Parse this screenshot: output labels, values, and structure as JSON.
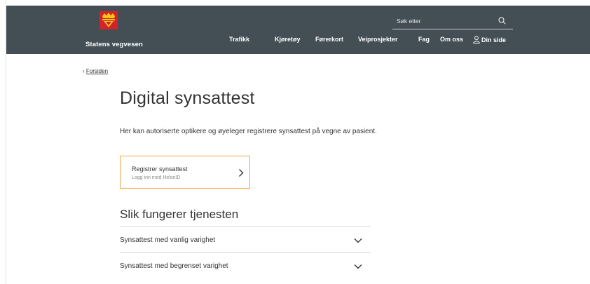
{
  "header": {
    "brand": "Statens vegvesen",
    "search": {
      "placeholder": "Søk etter"
    },
    "nav": [
      "Trafikk",
      "Kjøretøy",
      "Førerkort",
      "Veiprosjekter",
      "Fag",
      "Om oss",
      "Din side"
    ],
    "bg_color": "#444f55"
  },
  "breadcrumb": {
    "back_label": "Forsiden"
  },
  "main": {
    "title": "Digital synsattest",
    "intro": "Her kan autoriserte optikere og øyeleger registrere synsattest på vegne av pasient.",
    "cta": {
      "title": "Registrer synsattest",
      "subtitle": "Logg inn med HelseID",
      "border_color": "#f2a541"
    },
    "section_title": "Slik fungerer tjenesten",
    "accordion": [
      {
        "label": "Synsattest med vanlig varighet"
      },
      {
        "label": "Synsattest med begrenset varighet"
      }
    ]
  }
}
